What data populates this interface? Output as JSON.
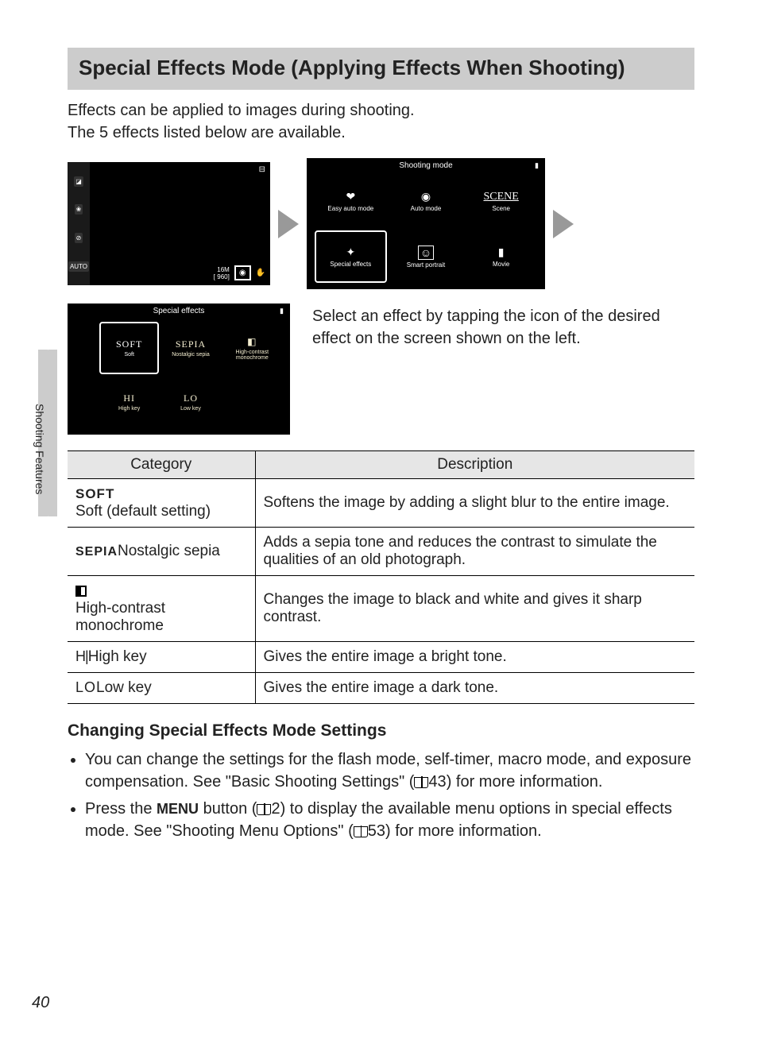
{
  "heading": "Special Effects Mode (Applying Effects When Shooting)",
  "intro_line1": "Effects can be applied to images during shooting.",
  "intro_line2": "The 5 effects listed below are available.",
  "side_tab": "Shooting Features",
  "page_number": "40",
  "camera_preview": {
    "sidebar_icons": [
      "◪",
      "❀",
      "⊘",
      "AUTO"
    ],
    "top_right_stack": "⊟",
    "bottom_counter_top": "16M",
    "bottom_counter_bottom": "[ 960]",
    "bottom_cam_icon": "◉",
    "bottom_hand_icon": "✋"
  },
  "shooting_mode_menu": {
    "title": "Shooting mode",
    "battery": "▮",
    "cells": [
      {
        "icon": "❤",
        "label": "Easy auto mode"
      },
      {
        "icon": "◉",
        "label": "Auto mode"
      },
      {
        "icon": "SCENE",
        "label": "Scene",
        "scene": true
      },
      {
        "icon": "✦",
        "label": "Special effects",
        "selected": true
      },
      {
        "icon": "☺",
        "label": "Smart portrait"
      },
      {
        "icon": "▮",
        "label": "Movie"
      }
    ]
  },
  "special_effects_menu": {
    "title": "Special effects",
    "battery": "▮",
    "cells": [
      {
        "top": "SOFT",
        "bottom": "Soft",
        "selected": true
      },
      {
        "top": "SEPIA",
        "bottom": "Nostalgic sepia"
      },
      {
        "top": "◧",
        "bottom": "High-contrast monochrome"
      },
      {
        "top": "HI",
        "bottom": "High key"
      },
      {
        "top": "LO",
        "bottom": "Low key"
      },
      {
        "top": "",
        "bottom": ""
      }
    ]
  },
  "select_text": "Select an effect by tapping the icon of the desired effect on the screen shown on the left.",
  "table": {
    "headers": [
      "Category",
      "Description"
    ],
    "rows": [
      {
        "sym_type": "soft",
        "sym": "SOFT",
        "cat": " Soft (default setting)",
        "desc": "Softens the image by adding a slight blur to the entire image."
      },
      {
        "sym_type": "sepia",
        "sym": "SEPIA",
        "cat": " Nostalgic sepia",
        "desc": "Adds a sepia tone and reduces the contrast to simulate the qualities of an old photograph."
      },
      {
        "sym_type": "hc",
        "sym": "",
        "cat": " High-contrast monochrome",
        "desc": "Changes the image to black and white and gives it sharp contrast."
      },
      {
        "sym_type": "hi",
        "sym": "HI",
        "cat": " High key",
        "desc": "Gives the entire image a bright tone."
      },
      {
        "sym_type": "lo",
        "sym": "LO",
        "cat": " Low key",
        "desc": "Gives the entire image a dark tone."
      }
    ]
  },
  "subheading": "Changing Special Effects Mode Settings",
  "bullets": {
    "b1_pre": "You can change the settings for the flash mode, self-timer, macro mode, and exposure compensation. See \"Basic Shooting Settings\" (",
    "b1_ref": "43",
    "b1_post": ") for more information.",
    "b2_pre": "Press the ",
    "b2_menu": "MENU",
    "b2_mid1": " button (",
    "b2_ref1": "2",
    "b2_mid2": ") to display the available menu options in special effects mode. See \"Shooting Menu Options\" (",
    "b2_ref2": "53",
    "b2_post": ") for more information."
  }
}
